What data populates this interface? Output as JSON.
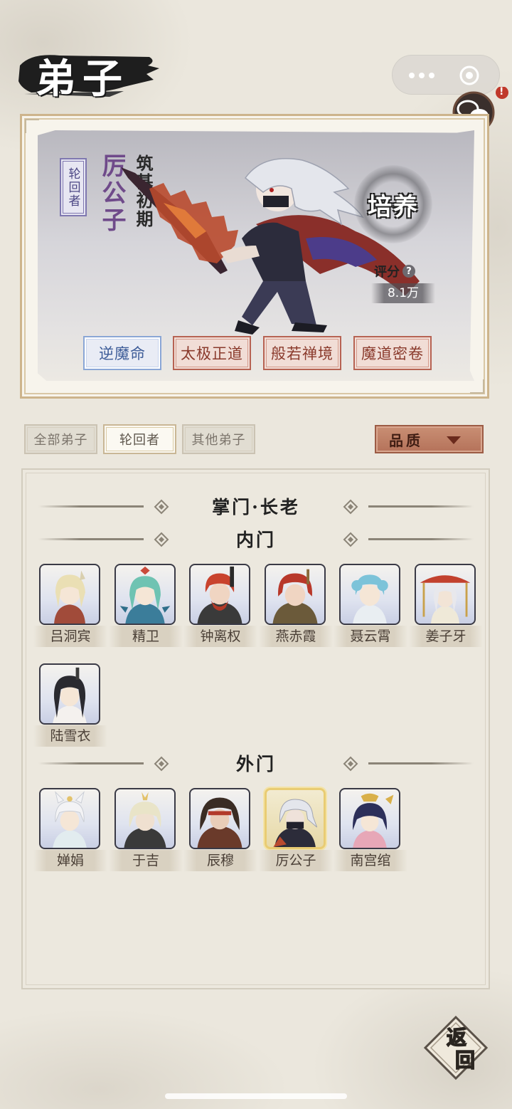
{
  "page": {
    "title": "弟子"
  },
  "capsule": {
    "more_icon": "more-dots-icon",
    "close_icon": "target-circle-icon"
  },
  "chat": {
    "icon": "chat-bubbles-icon",
    "alert": "!"
  },
  "hero": {
    "rank_tag": "轮回者",
    "name": "厉公子",
    "realm": "筑基初期",
    "train_label": "培养",
    "score_label": "评分",
    "score_help": "?",
    "score_value": "8.1万",
    "skills": [
      {
        "label": "逆魔命",
        "state": "active"
      },
      {
        "label": "太极正道",
        "state": "normal"
      },
      {
        "label": "般若禅境",
        "state": "normal"
      },
      {
        "label": "魔道密卷",
        "state": "normal"
      }
    ]
  },
  "filters": {
    "tabs": [
      "全部弟子",
      "轮回者",
      "其他弟子"
    ],
    "active_tab": "轮回者",
    "quality_label": "品质"
  },
  "sections": {
    "elders": "掌门·长老",
    "inner": "内门",
    "outer": "外门"
  },
  "inner_members": [
    "吕洞宾",
    "精卫",
    "钟离权",
    "燕赤霞",
    "聂云霄",
    "姜子牙",
    "陆雪衣"
  ],
  "outer_members": [
    "婵娟",
    "于吉",
    "辰穆",
    "厉公子",
    "南宫绾"
  ],
  "selected_member": "厉公子",
  "return": {
    "label_top": "返",
    "label_bottom": "回"
  },
  "colors": {
    "background": "#ebe7dd",
    "skill_active": "#8aa6d6",
    "skill_red": "#b76353",
    "quality_button": "#b5725a",
    "selected_frame": "#e9cc73",
    "alert_red": "#c0392b"
  }
}
